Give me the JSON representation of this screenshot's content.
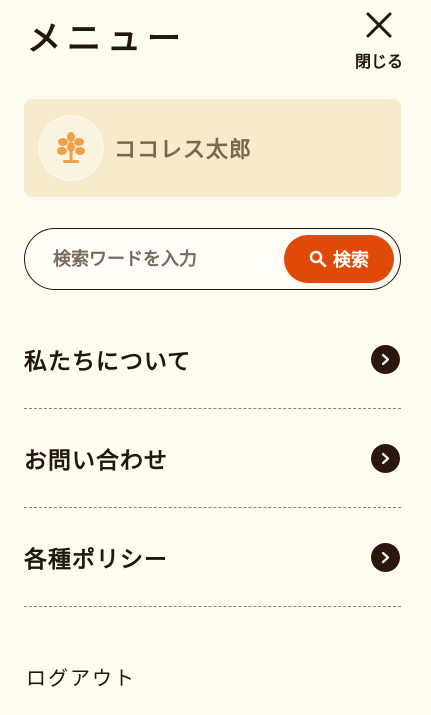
{
  "header": {
    "title": "メニュー",
    "close_label": "閉じる",
    "close_icon": "close-icon"
  },
  "user": {
    "name": "ココレス太郎",
    "avatar_icon": "leaf-logo-icon"
  },
  "search": {
    "placeholder": "検索ワードを入力",
    "value": "",
    "button_label": "検索",
    "button_icon": "search-icon"
  },
  "nav": {
    "items": [
      {
        "label": "私たちについて",
        "icon": "chevron-right-icon"
      },
      {
        "label": "お問い合わせ",
        "icon": "chevron-right-icon"
      },
      {
        "label": "各種ポリシー",
        "icon": "chevron-right-icon"
      }
    ]
  },
  "logout": {
    "label": "ログアウト"
  },
  "colors": {
    "background": "#fefbf0",
    "card": "#f6ebcb",
    "accent": "#e04a08",
    "text": "#22170d",
    "chevron_bg": "#2a170c"
  }
}
